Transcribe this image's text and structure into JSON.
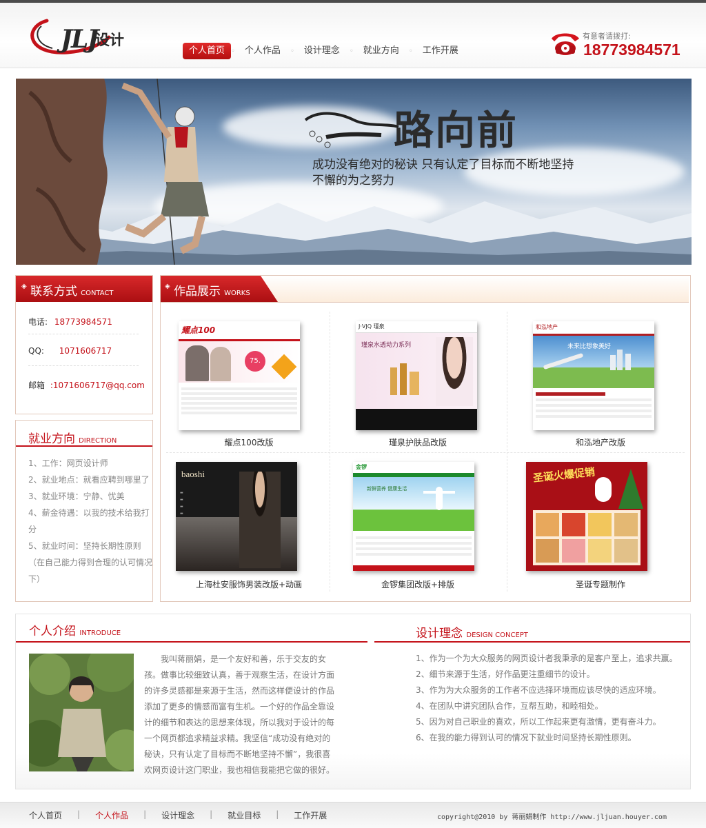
{
  "header": {
    "logo_text": "JLJ",
    "logo_sub": "设计",
    "phone_label": "有意者请拨打:",
    "phone_number": "18773984571"
  },
  "nav": {
    "items": [
      {
        "label": "个人首页",
        "active": true
      },
      {
        "label": "个人作品"
      },
      {
        "label": "设计理念"
      },
      {
        "label": "就业方向"
      },
      {
        "label": "工作开展"
      }
    ]
  },
  "banner": {
    "title": "路向前",
    "subtitle_line1": "成功没有绝对的秘诀 只有认定了目标而不断地坚持",
    "subtitle_line2": "不懈的为之努力"
  },
  "contact": {
    "title_zh": "联系方式",
    "title_en": "CONTACT",
    "phone_label": "电话:",
    "phone_value": "18773984571",
    "qq_label": "QQ:",
    "qq_value": "1071606717",
    "email_label": "邮箱",
    "email_value": ":1071606717@qq.com"
  },
  "direction": {
    "title_zh": "就业方向",
    "title_en": "DIRECTION",
    "items": [
      "1、工作：网页设计师",
      "2、就业地点：就看应聘到哪里了",
      "3、就业环境：宁静、忧美",
      "4、薪金待遇：以我的技术给我打分",
      "5、就业时间：坚持长期性原则（在自己能力得到合理的认可情况下）"
    ]
  },
  "works": {
    "title_zh": "作品展示",
    "title_en": "WORKS",
    "items": [
      {
        "label": "耀点100改版",
        "logo": "耀点100",
        "price": "75."
      },
      {
        "label": "瑾泉护肤品改版",
        "logo": "J·VJQ 瑾泉",
        "heading": "瑾泉水透动力系列"
      },
      {
        "label": "和泓地产改版",
        "logo": "和泓地产",
        "heading": "未来比想象美好"
      },
      {
        "label": "上海杜安服饰男装改版+动画",
        "logo": "baoshi"
      },
      {
        "label": "金锣集团改版+排版",
        "logo": "金锣",
        "heading": "新鲜营养 健康生活"
      },
      {
        "label": "圣诞专题制作",
        "heading": "圣诞火爆促销"
      }
    ]
  },
  "introduce": {
    "title_zh": "个人介绍",
    "title_en": "INTRODUCE",
    "text": "我叫蒋丽娟，是一个友好和善，乐于交友的女孩。做事比较细致认真，善于观察生活，在设计方面的许多灵感都是来源于生活，然而这样便设计的作品添加了更多的情感而富有生机。一个好的作品全靠设计的细节和表达的思想来体现，所以我对于设计的每一个网页都追求精益求精。我坚信“成功没有绝对的秘诀，只有认定了目标而不断地坚持不懈”，我很喜欢网页设计这门职业，我也相信我能把它做的很好。"
  },
  "concept": {
    "title_zh": "设计理念",
    "title_en": "DESIGN CONCEPT",
    "items": [
      "1、作为一个为大众服务的网页设计者我秉承的是客户至上，追求共赢。",
      "2、细节来源于生活，好作品更注重细节的设计。",
      "3、作为为大众服务的工作者不应选择环境而应该尽快的适应环境。",
      "4、在团队中讲究团队合作，互帮互助，和睦相处。",
      "5、因为对自己职业的喜欢，所以工作起来更有激情，更有奋斗力。",
      "6、在我的能力得到认可的情况下就业时间坚持长期性原则。"
    ]
  },
  "footer": {
    "items": [
      {
        "label": "个人首页"
      },
      {
        "label": "个人作品",
        "active": true
      },
      {
        "label": "设计理念"
      },
      {
        "label": "就业目标"
      },
      {
        "label": "工作开展"
      }
    ],
    "copyright": "copyright@2010 by 蒋丽娟制作  http://www.jljuan.houyer.com"
  },
  "colors": {
    "brand_red": "#c4121a",
    "header_dark": "#4a4a4a"
  },
  "icons": [
    "telephone-icon",
    "diamond-bullet-icon",
    "shoe-prints-icon"
  ]
}
